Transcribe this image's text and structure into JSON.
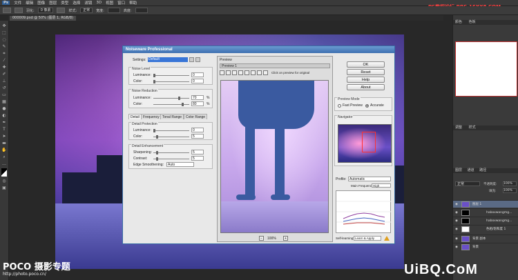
{
  "app": {
    "logo": "Ps",
    "menu": [
      "文件",
      "编辑",
      "图像",
      "图层",
      "类型",
      "选择",
      "滤镜",
      "3D",
      "视图",
      "窗口",
      "帮助"
    ],
    "options": {
      "feather_label": "羽化:",
      "feather_value": "0 像素",
      "style_label": "样式:",
      "style_value": "正常",
      "width_label": "宽度:",
      "height_label": "高度:"
    },
    "document_tab": "000009.psd @ 50% (图层 1, RGB/8)"
  },
  "dialog": {
    "title": "Noiseware Professional",
    "settings_label": "Settings:",
    "settings_value": "Default",
    "noise_level": {
      "title": "Noise Level",
      "luminance_label": "Luminance:",
      "luminance_value": "0",
      "color_label": "Color:",
      "color_value": "0"
    },
    "noise_reduction": {
      "title": "Noise Reduction",
      "luminance_label": "Luminance:",
      "luminance_value": "70",
      "color_label": "Color:",
      "color_value": "80",
      "unit": "%"
    },
    "tabs": [
      "Detail",
      "Frequency",
      "Tonal Range",
      "Color Range"
    ],
    "detail_protection": {
      "title": "Detail Protection",
      "luminance_label": "Luminance:",
      "luminance_value": "0",
      "color_label": "Color:",
      "color_value": "5"
    },
    "detail_enhancement": {
      "title": "Detail Enhancement",
      "sharpening_label": "Sharpening:",
      "sharpening_value": "5",
      "contrast_label": "Contrast:",
      "contrast_value": "5",
      "edge_label": "Edge Smoothening:",
      "edge_value": "Auto"
    },
    "preview": {
      "title": "Preview",
      "selector": "Preview 1",
      "hint": "Click on preview for original",
      "zoom": "100%"
    },
    "buttons": {
      "ok": "OK",
      "reset": "Reset",
      "help": "Help",
      "about": "About"
    },
    "preview_mode": {
      "title": "Preview Mode",
      "fast": "Fast Preview",
      "accurate": "Accurate"
    },
    "navigator": {
      "title": "Navigator"
    },
    "profile": {
      "label": "Profile:",
      "value": "Automatic",
      "freq_label": "Main Frequency:",
      "freq_value": "High"
    },
    "self_learning": {
      "label": "Self-learning:",
      "value": "Learn & Apply"
    }
  },
  "panels": {
    "tabs_top": [
      "颜色",
      "色板"
    ],
    "tabs_mid": [
      "调整",
      "样式"
    ],
    "tabs_layers": [
      "图层",
      "通道",
      "路径"
    ],
    "blend_mode": "正常",
    "opacity_label": "不透明度:",
    "opacity_value": "100%",
    "fill_label": "填充:",
    "fill_value": "100%",
    "layers": [
      "图层 1",
      "haboxwangmg...",
      "haboxwangmg...",
      "色相/饱和度 1",
      "背景 副本",
      "背景"
    ]
  },
  "watermarks": {
    "poco": "POCO 摄影专题",
    "url": "http://photo.poco.cn/",
    "uibq": "UiBQ.CoM",
    "site": "PS教程论坛 BBS.16XX8.COM"
  }
}
